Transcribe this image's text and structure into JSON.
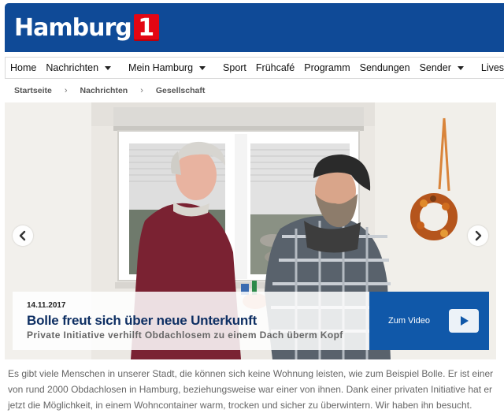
{
  "brand": {
    "name": "Hamburg",
    "number": "1"
  },
  "nav": {
    "items": [
      {
        "label": "Home"
      },
      {
        "label": "Nachrichten"
      },
      {
        "label": "Mein Hamburg"
      },
      {
        "label": "Sport"
      },
      {
        "label": "Frühcafé"
      },
      {
        "label": "Programm"
      },
      {
        "label": "Sendungen"
      },
      {
        "label": "Sender"
      },
      {
        "label": "Livestream"
      }
    ]
  },
  "breadcrumb": [
    "Startseite",
    "Nachrichten",
    "Gesellschaft"
  ],
  "hero": {
    "date": "14.11.2017",
    "title": "Bolle freut sich über neue Unterkunft",
    "subtitle": "Private Initiative verhilft Obdachlosem zu einem Dach überm Kopf",
    "video_label": "Zum Video"
  },
  "teaser": "Es gibt viele Menschen in unserer Stadt, die können sich keine Wohnung leisten, wie zum Beispiel Bolle. Er ist einer von rund 2000 Obdachlosen in Hamburg, beziehungsweise war einer von ihnen. Dank einer privaten Initiative hat er jetzt die Möglichkeit, in einem Wohncontainer warm, trocken und sicher zu überwintern. Wir haben ihn besucht.",
  "colors": {
    "header": "#0f4a97",
    "logo_box": "#e30613",
    "video_button": "#1058a9",
    "title": "#0e2f63"
  },
  "icons": [
    "chevron-left-icon",
    "chevron-right-icon",
    "play-icon",
    "caret-down-icon"
  ]
}
